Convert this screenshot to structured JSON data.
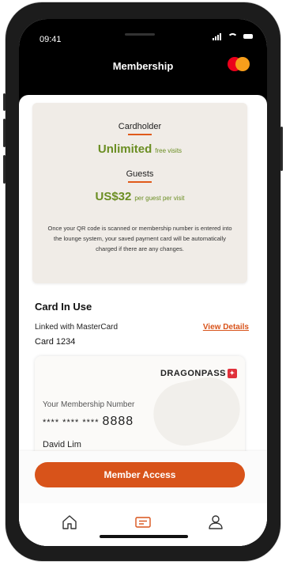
{
  "status": {
    "time": "09:41"
  },
  "header": {
    "title": "Membership",
    "brand_icon": "mastercard-logo"
  },
  "info_card": {
    "cardholder_label": "Cardholder",
    "cardholder_value": "Unlimited",
    "cardholder_suffix": "free visits",
    "guests_label": "Guests",
    "guests_value": "US$32",
    "guests_suffix": "per guest per visit",
    "description": "Once your QR code is scanned or membership number is entered into the lounge system, your saved payment card will be automatically charged if there are any changes."
  },
  "card_in_use": {
    "title": "Card In Use",
    "linked_text": "Linked with MasterCard",
    "view_details": "View Details",
    "card_label": "Card 1234"
  },
  "membership_card": {
    "brand": "DRAGONPASS",
    "number_label": "Your Membership Number",
    "masked_prefix": "**** **** ****",
    "last_digits": "8888",
    "holder_name": "David Lim"
  },
  "actions": {
    "member_access": "Member Access"
  },
  "tabs": [
    {
      "name": "home",
      "icon": "home-icon"
    },
    {
      "name": "membership",
      "icon": "card-icon"
    },
    {
      "name": "profile",
      "icon": "user-icon"
    }
  ],
  "colors": {
    "accent": "#d8531a",
    "green": "#6b8e23",
    "card_bg": "#f0ece7"
  }
}
